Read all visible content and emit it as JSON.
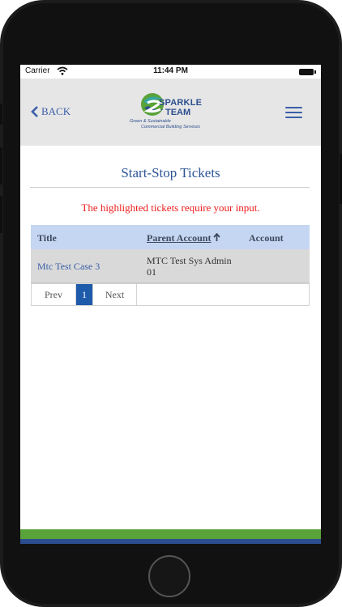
{
  "status_bar": {
    "carrier": "Carrier",
    "time": "11:44 PM"
  },
  "header": {
    "back_label": "BACK",
    "logo": {
      "word1": "SPARKLE",
      "word2": "TEAM",
      "tagline1": "Green & Sustainable",
      "tagline2": "Commercial Building Services",
      "colors": {
        "green": "#5aa23a",
        "blue": "#2c4e8e",
        "teal": "#36a6a0"
      }
    }
  },
  "page": {
    "title": "Start-Stop Tickets",
    "notice": "The highlighted tickets require your input."
  },
  "grid": {
    "columns": [
      {
        "label": "Title"
      },
      {
        "label": "Parent Account"
      },
      {
        "label": "Account"
      }
    ],
    "rows": [
      {
        "title": "Mtc Test Case 3",
        "parent_account": "MTC Test Sys Admin 01",
        "account": ""
      }
    ]
  },
  "pager": {
    "prev": "Prev",
    "current": "1",
    "next": "Next"
  },
  "colors": {
    "accent": "#3a5fa8",
    "notice": "#ee1c1c",
    "header_bg": "#c5d6f2",
    "row_highlight": "#d9d9d9",
    "page_current": "#1f5bab"
  }
}
